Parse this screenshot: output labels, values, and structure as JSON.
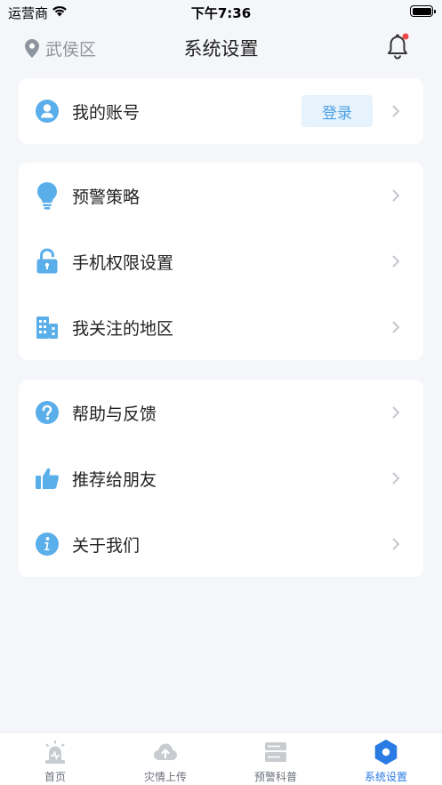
{
  "status_bar": {
    "carrier": "运营商",
    "time": "下午7:36"
  },
  "header": {
    "location": "武侯区",
    "title": "系统设置"
  },
  "account": {
    "label": "我的账号",
    "login_label": "登录"
  },
  "group1": [
    {
      "label": "预警策略",
      "icon": "lightbulb-icon"
    },
    {
      "label": "手机权限设置",
      "icon": "lock-icon"
    },
    {
      "label": "我关注的地区",
      "icon": "building-icon"
    }
  ],
  "group2": [
    {
      "label": "帮助与反馈",
      "icon": "question-icon"
    },
    {
      "label": "推荐给朋友",
      "icon": "thumbs-up-icon"
    },
    {
      "label": "关于我们",
      "icon": "info-icon"
    }
  ],
  "tabbar": [
    {
      "label": "首页",
      "icon": "alarm-icon"
    },
    {
      "label": "灾情上传",
      "icon": "cloud-upload-icon"
    },
    {
      "label": "预警科普",
      "icon": "book-icon"
    },
    {
      "label": "系统设置",
      "icon": "settings-hexagon-icon",
      "active": true
    }
  ],
  "colors": {
    "accent": "#2a7be4",
    "icon_blue": "#5aaeea",
    "notification_dot": "#f04848"
  }
}
